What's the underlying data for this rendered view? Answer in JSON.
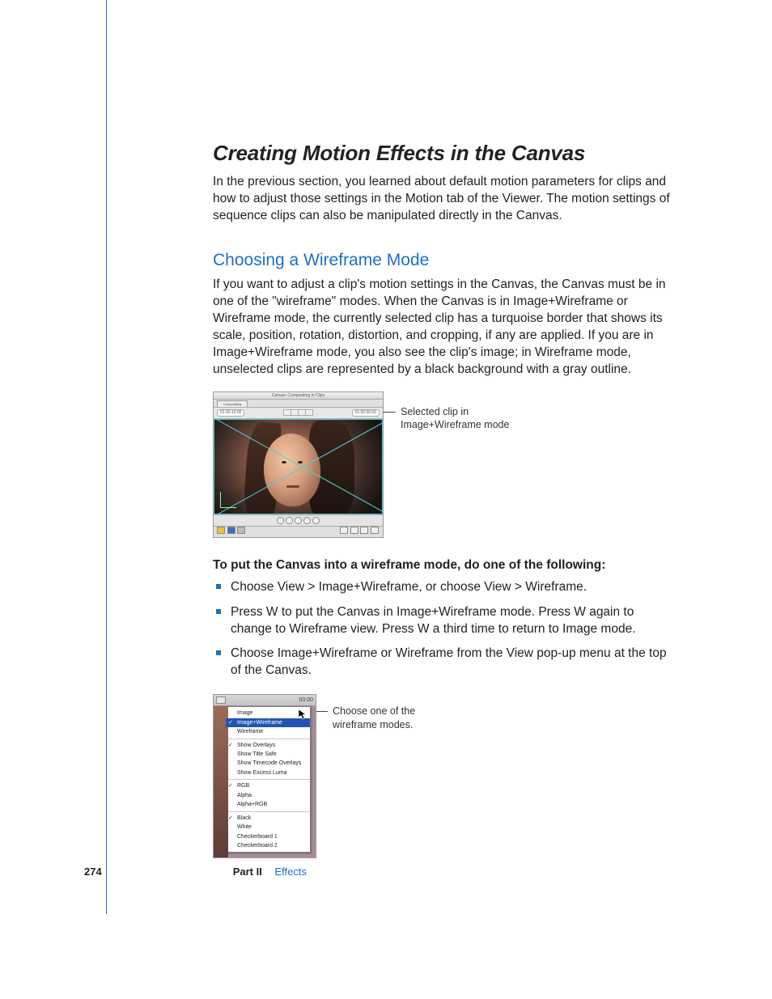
{
  "section_title": "Creating Motion Effects in the Canvas",
  "intro_para": "In the previous section, you learned about default motion parameters for clips and how to adjust those settings in the Motion tab of the Viewer. The motion settings of sequence clips can also be manipulated directly in the Canvas.",
  "sub_heading": "Choosing a Wireframe Mode",
  "wireframe_para": "If you want to adjust a clip's motion settings in the Canvas, the Canvas must be in one of the \"wireframe\" modes. When the Canvas is in Image+Wireframe or Wireframe mode, the currently selected clip has a turquoise border that shows its scale, position, rotation, distortion, and cropping, if any are applied. If you are in Image+Wireframe mode, you also see the clip's image; in Wireframe mode, unselected clips are represented by a black background with a gray outline.",
  "canvas_window": {
    "title": "Canvas: Compositing In Clips",
    "tab": "Compositing",
    "tc_left": "01:00:10:06",
    "tc_right": "01:00:00:00"
  },
  "callout_fig1_l1": "Selected clip in",
  "callout_fig1_l2": "Image+Wireframe mode",
  "instr_bold": "To put the Canvas into a wireframe mode, do one of the following:",
  "bullets": [
    "Choose View > Image+Wireframe, or choose View > Wireframe.",
    "Press W to put the Canvas in Image+Wireframe mode. Press W again to change to Wireframe view. Press W a third time to return to Image mode.",
    "Choose Image+Wireframe or Wireframe from the View pop-up menu at the top of the Canvas."
  ],
  "menu": {
    "tc": "00:00",
    "groups": [
      {
        "items": [
          {
            "label": "Image",
            "checked": false,
            "selected": false
          },
          {
            "label": "Image+Wireframe",
            "checked": true,
            "selected": true
          },
          {
            "label": "Wireframe",
            "checked": false,
            "selected": false
          }
        ]
      },
      {
        "items": [
          {
            "label": "Show Overlays",
            "checked": true,
            "selected": false
          },
          {
            "label": "Show Title Safe",
            "checked": false,
            "selected": false
          },
          {
            "label": "Show Timecode Overlays",
            "checked": false,
            "selected": false
          },
          {
            "label": "Show Excess Luma",
            "checked": false,
            "selected": false
          }
        ]
      },
      {
        "items": [
          {
            "label": "RGB",
            "checked": true,
            "selected": false
          },
          {
            "label": "Alpha",
            "checked": false,
            "selected": false
          },
          {
            "label": "Alpha+RGB",
            "checked": false,
            "selected": false
          }
        ]
      },
      {
        "items": [
          {
            "label": "Black",
            "checked": true,
            "selected": false
          },
          {
            "label": "White",
            "checked": false,
            "selected": false
          },
          {
            "label": "Checkerboard 1",
            "checked": false,
            "selected": false
          },
          {
            "label": "Checkerboard 2",
            "checked": false,
            "selected": false
          }
        ]
      }
    ]
  },
  "callout_fig2_l1": "Choose one of the",
  "callout_fig2_l2": "wireframe modes.",
  "footer": {
    "page": "274",
    "part_label": "Part II",
    "part_name": "Effects"
  }
}
